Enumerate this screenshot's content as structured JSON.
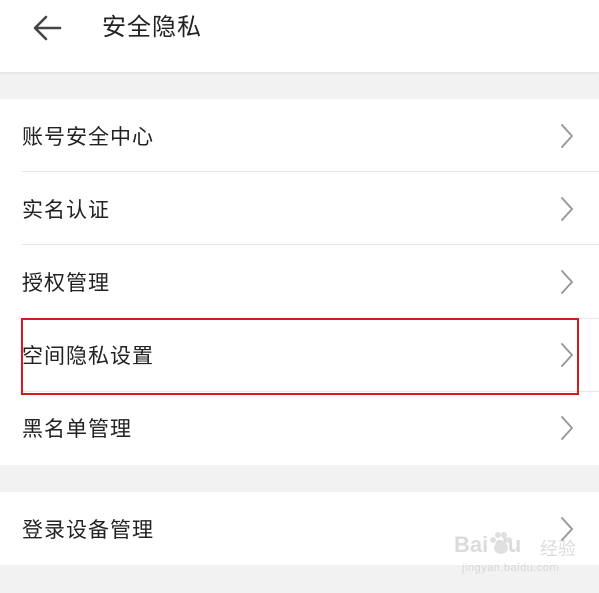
{
  "header": {
    "title": "安全隐私",
    "back_icon": "arrow-left-icon"
  },
  "settings": {
    "group1": [
      {
        "label": "账号安全中心",
        "icon": "chevron-right-icon"
      },
      {
        "label": "实名认证",
        "icon": "chevron-right-icon"
      },
      {
        "label": "授权管理",
        "icon": "chevron-right-icon"
      },
      {
        "label": "空间隐私设置",
        "icon": "chevron-right-icon",
        "highlighted": true
      },
      {
        "label": "黑名单管理",
        "icon": "chevron-right-icon"
      }
    ],
    "group2": [
      {
        "label": "登录设备管理",
        "icon": "chevron-right-icon"
      }
    ]
  },
  "watermark": {
    "brand": "Bai du",
    "cn": "经验",
    "url": "jingyan.baidu.com"
  },
  "colors": {
    "background": "#f2f2f2",
    "surface": "#ffffff",
    "text": "#222222",
    "chevron": "#9a9a9a",
    "divider": "#e6e6e6",
    "highlight": "#d9191e"
  }
}
